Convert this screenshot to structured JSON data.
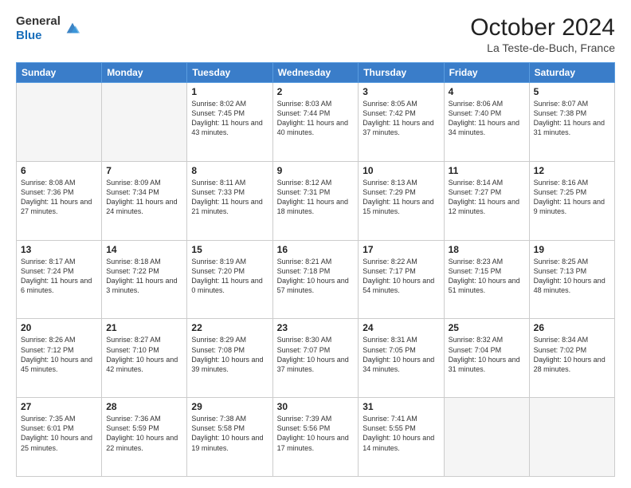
{
  "header": {
    "logo": {
      "general": "General",
      "blue": "Blue"
    },
    "title": "October 2024",
    "subtitle": "La Teste-de-Buch, France"
  },
  "weekdays": [
    "Sunday",
    "Monday",
    "Tuesday",
    "Wednesday",
    "Thursday",
    "Friday",
    "Saturday"
  ],
  "weeks": [
    [
      {
        "day": "",
        "empty": true
      },
      {
        "day": "",
        "empty": true
      },
      {
        "day": "1",
        "sunrise": "8:02 AM",
        "sunset": "7:45 PM",
        "daylight": "11 hours and 43 minutes."
      },
      {
        "day": "2",
        "sunrise": "8:03 AM",
        "sunset": "7:44 PM",
        "daylight": "11 hours and 40 minutes."
      },
      {
        "day": "3",
        "sunrise": "8:05 AM",
        "sunset": "7:42 PM",
        "daylight": "11 hours and 37 minutes."
      },
      {
        "day": "4",
        "sunrise": "8:06 AM",
        "sunset": "7:40 PM",
        "daylight": "11 hours and 34 minutes."
      },
      {
        "day": "5",
        "sunrise": "8:07 AM",
        "sunset": "7:38 PM",
        "daylight": "11 hours and 31 minutes."
      }
    ],
    [
      {
        "day": "6",
        "sunrise": "8:08 AM",
        "sunset": "7:36 PM",
        "daylight": "11 hours and 27 minutes."
      },
      {
        "day": "7",
        "sunrise": "8:09 AM",
        "sunset": "7:34 PM",
        "daylight": "11 hours and 24 minutes."
      },
      {
        "day": "8",
        "sunrise": "8:11 AM",
        "sunset": "7:33 PM",
        "daylight": "11 hours and 21 minutes."
      },
      {
        "day": "9",
        "sunrise": "8:12 AM",
        "sunset": "7:31 PM",
        "daylight": "11 hours and 18 minutes."
      },
      {
        "day": "10",
        "sunrise": "8:13 AM",
        "sunset": "7:29 PM",
        "daylight": "11 hours and 15 minutes."
      },
      {
        "day": "11",
        "sunrise": "8:14 AM",
        "sunset": "7:27 PM",
        "daylight": "11 hours and 12 minutes."
      },
      {
        "day": "12",
        "sunrise": "8:16 AM",
        "sunset": "7:25 PM",
        "daylight": "11 hours and 9 minutes."
      }
    ],
    [
      {
        "day": "13",
        "sunrise": "8:17 AM",
        "sunset": "7:24 PM",
        "daylight": "11 hours and 6 minutes."
      },
      {
        "day": "14",
        "sunrise": "8:18 AM",
        "sunset": "7:22 PM",
        "daylight": "11 hours and 3 minutes."
      },
      {
        "day": "15",
        "sunrise": "8:19 AM",
        "sunset": "7:20 PM",
        "daylight": "11 hours and 0 minutes."
      },
      {
        "day": "16",
        "sunrise": "8:21 AM",
        "sunset": "7:18 PM",
        "daylight": "10 hours and 57 minutes."
      },
      {
        "day": "17",
        "sunrise": "8:22 AM",
        "sunset": "7:17 PM",
        "daylight": "10 hours and 54 minutes."
      },
      {
        "day": "18",
        "sunrise": "8:23 AM",
        "sunset": "7:15 PM",
        "daylight": "10 hours and 51 minutes."
      },
      {
        "day": "19",
        "sunrise": "8:25 AM",
        "sunset": "7:13 PM",
        "daylight": "10 hours and 48 minutes."
      }
    ],
    [
      {
        "day": "20",
        "sunrise": "8:26 AM",
        "sunset": "7:12 PM",
        "daylight": "10 hours and 45 minutes."
      },
      {
        "day": "21",
        "sunrise": "8:27 AM",
        "sunset": "7:10 PM",
        "daylight": "10 hours and 42 minutes."
      },
      {
        "day": "22",
        "sunrise": "8:29 AM",
        "sunset": "7:08 PM",
        "daylight": "10 hours and 39 minutes."
      },
      {
        "day": "23",
        "sunrise": "8:30 AM",
        "sunset": "7:07 PM",
        "daylight": "10 hours and 37 minutes."
      },
      {
        "day": "24",
        "sunrise": "8:31 AM",
        "sunset": "7:05 PM",
        "daylight": "10 hours and 34 minutes."
      },
      {
        "day": "25",
        "sunrise": "8:32 AM",
        "sunset": "7:04 PM",
        "daylight": "10 hours and 31 minutes."
      },
      {
        "day": "26",
        "sunrise": "8:34 AM",
        "sunset": "7:02 PM",
        "daylight": "10 hours and 28 minutes."
      }
    ],
    [
      {
        "day": "27",
        "sunrise": "7:35 AM",
        "sunset": "6:01 PM",
        "daylight": "10 hours and 25 minutes."
      },
      {
        "day": "28",
        "sunrise": "7:36 AM",
        "sunset": "5:59 PM",
        "daylight": "10 hours and 22 minutes."
      },
      {
        "day": "29",
        "sunrise": "7:38 AM",
        "sunset": "5:58 PM",
        "daylight": "10 hours and 19 minutes."
      },
      {
        "day": "30",
        "sunrise": "7:39 AM",
        "sunset": "5:56 PM",
        "daylight": "10 hours and 17 minutes."
      },
      {
        "day": "31",
        "sunrise": "7:41 AM",
        "sunset": "5:55 PM",
        "daylight": "10 hours and 14 minutes."
      },
      {
        "day": "",
        "empty": true
      },
      {
        "day": "",
        "empty": true
      }
    ]
  ],
  "labels": {
    "sunrise": "Sunrise:",
    "sunset": "Sunset:",
    "daylight": "Daylight:"
  }
}
